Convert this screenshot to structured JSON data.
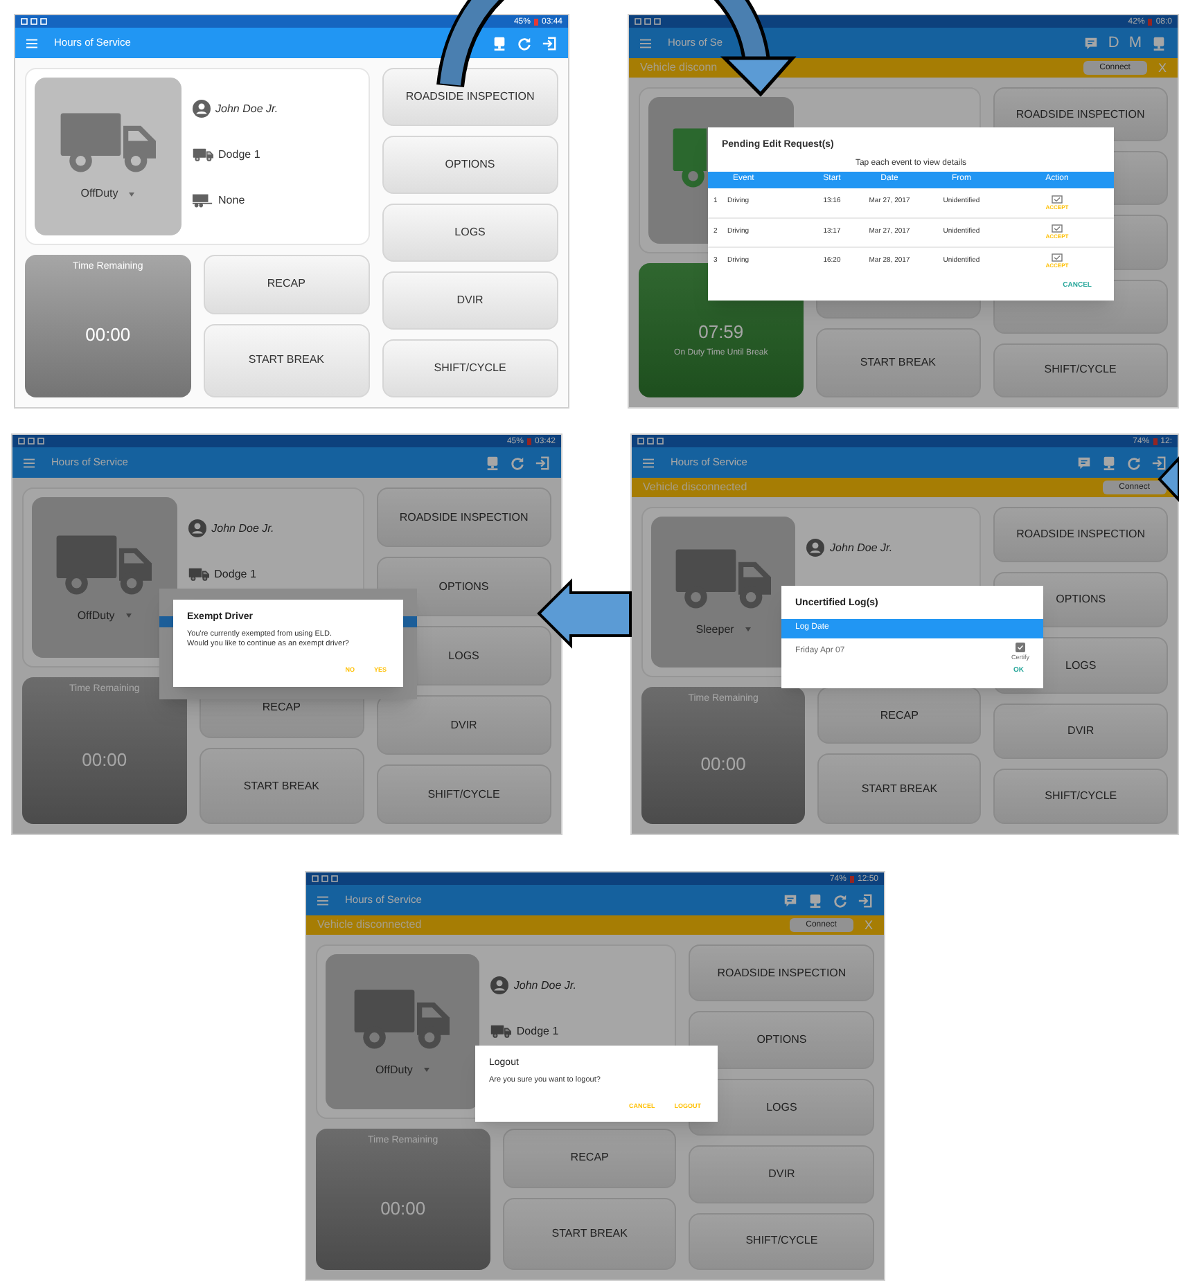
{
  "panels": [
    {
      "dimmed": false,
      "on_duty": false,
      "status_bar": {
        "battery": "45%",
        "time": "03:44"
      },
      "app_bar": {
        "title": "Hours of Service",
        "actions": [
          {
            "kind": "monitor"
          },
          {
            "kind": "refresh"
          },
          {
            "kind": "logout"
          }
        ]
      },
      "driver": {
        "status": "OffDuty",
        "name": "John Doe Jr.",
        "vehicle": "Dodge 1",
        "trailer": "None"
      },
      "time_card": {
        "label": "Time Remaining",
        "value": "00:00"
      },
      "break_buttons": [
        {
          "label": "RECAP"
        },
        {
          "label": "START BREAK"
        }
      ],
      "buttons": [
        {
          "label": "ROADSIDE INSPECTION"
        },
        {
          "label": "OPTIONS"
        },
        {
          "label": "LOGS"
        },
        {
          "label": "DVIR"
        },
        {
          "label": "SHIFT/CYCLE"
        }
      ]
    },
    {
      "dimmed": true,
      "on_duty": true,
      "status_bar": {
        "battery": "42%",
        "time": "08:0"
      },
      "app_bar": {
        "title": "Hours of Se",
        "actions": [
          {
            "kind": "message"
          },
          {
            "kind": "letter",
            "text": "D"
          },
          {
            "kind": "letter",
            "text": "M"
          },
          {
            "kind": "monitor"
          }
        ]
      },
      "banner": {
        "text": "Vehicle disconn",
        "connect": "Connect",
        "close": "X"
      },
      "time_card": {
        "value": "07:59",
        "sublabel": "On Duty Time Until Break"
      },
      "break_buttons": [
        {
          "covered": true
        },
        {
          "label": "START BREAK"
        }
      ],
      "buttons": [
        {
          "label": "ROADSIDE INSPECTION"
        },
        {
          "covered": true
        },
        {
          "covered": true
        },
        {
          "covered": true
        },
        {
          "label": "SHIFT/CYCLE"
        }
      ],
      "dialog": {
        "kind": "pending_edits",
        "title": "Pending Edit Request(s)",
        "subtitle": "Tap each event to view details",
        "columns": [
          "Event",
          "Start",
          "Date",
          "From",
          "Action"
        ],
        "rows": [
          {
            "index": "1",
            "event": "Driving",
            "start": "13:16",
            "date": "Mar 27, 2017",
            "from": "Unidentified",
            "action": "ACCEPT"
          },
          {
            "index": "2",
            "event": "Driving",
            "start": "13:17",
            "date": "Mar 27, 2017",
            "from": "Unidentified",
            "action": "ACCEPT"
          },
          {
            "index": "3",
            "event": "Driving",
            "start": "16:20",
            "date": "Mar 28, 2017",
            "from": "Unidentified",
            "action": "ACCEPT"
          }
        ],
        "buttons": [
          "CANCEL"
        ]
      }
    },
    {
      "dimmed": true,
      "on_duty": false,
      "status_bar": {
        "battery": "45%",
        "time": "03:42"
      },
      "app_bar": {
        "title": "Hours of Service",
        "actions": [
          {
            "kind": "monitor"
          },
          {
            "kind": "refresh"
          },
          {
            "kind": "logout"
          }
        ]
      },
      "driver": {
        "status": "OffDuty",
        "name": "John Doe Jr.",
        "vehicle": "Dodge 1"
      },
      "time_card": {
        "label": "Time Remaining",
        "value": "00:00"
      },
      "break_buttons": [
        {
          "label": "RECAP"
        },
        {
          "label": "START BREAK"
        }
      ],
      "buttons": [
        {
          "label": "ROADSIDE INSPECTION"
        },
        {
          "label": "OPTIONS"
        },
        {
          "label": "LOGS"
        },
        {
          "label": "DVIR"
        },
        {
          "label": "SHIFT/CYCLE"
        }
      ],
      "dialog": {
        "kind": "exempt",
        "stacked": true,
        "title": "Exempt Driver",
        "message": "You're currently exempted from using ELD.\nWould you like to continue as an exempt driver?",
        "buttons": [
          "NO",
          "YES"
        ]
      }
    },
    {
      "dimmed": true,
      "on_duty": false,
      "status_bar": {
        "battery": "74%",
        "time": "12:"
      },
      "app_bar": {
        "title": "Hours of Service",
        "actions": [
          {
            "kind": "message"
          },
          {
            "kind": "monitor"
          },
          {
            "kind": "refresh"
          },
          {
            "kind": "logout"
          }
        ]
      },
      "banner": {
        "text": "Vehicle disconnected",
        "connect": "Connect"
      },
      "driver": {
        "status": "Sleeper",
        "name": "John Doe Jr."
      },
      "time_card": {
        "label": "Time Remaining",
        "value": "00:00"
      },
      "break_buttons": [
        {
          "label": "RECAP"
        },
        {
          "label": "START BREAK"
        }
      ],
      "buttons": [
        {
          "label": "ROADSIDE INSPECTION"
        },
        {
          "label": "OPTIONS"
        },
        {
          "label": "LOGS"
        },
        {
          "label": "DVIR"
        },
        {
          "label": "SHIFT/CYCLE"
        }
      ],
      "dialog": {
        "kind": "uncertified",
        "title": "Uncertified Log(s)",
        "header": "Log Date",
        "rows": [
          {
            "date": "Friday Apr 07",
            "checked": true,
            "action": "Certify"
          }
        ],
        "buttons": [
          "OK"
        ]
      }
    },
    {
      "dimmed": true,
      "on_duty": false,
      "status_bar": {
        "battery": "74%",
        "time": "12:50"
      },
      "app_bar": {
        "title": "Hours of Service",
        "actions": [
          {
            "kind": "message"
          },
          {
            "kind": "monitor"
          },
          {
            "kind": "refresh"
          },
          {
            "kind": "logout"
          }
        ]
      },
      "banner": {
        "text": "Vehicle disconnected",
        "connect": "Connect",
        "close": "X"
      },
      "driver": {
        "status": "OffDuty",
        "name": "John Doe Jr.",
        "vehicle": "Dodge 1"
      },
      "time_card": {
        "label": "Time Remaining",
        "value": "00:00"
      },
      "break_buttons": [
        {
          "label": "RECAP"
        },
        {
          "label": "START BREAK"
        }
      ],
      "buttons": [
        {
          "label": "ROADSIDE INSPECTION"
        },
        {
          "label": "OPTIONS"
        },
        {
          "label": "LOGS"
        },
        {
          "label": "DVIR"
        },
        {
          "label": "SHIFT/CYCLE"
        }
      ],
      "dialog": {
        "kind": "logout",
        "title": "Logout",
        "message": "Are you sure you want to logout?",
        "buttons": [
          "CANCEL",
          "LOGOUT"
        ]
      }
    }
  ]
}
